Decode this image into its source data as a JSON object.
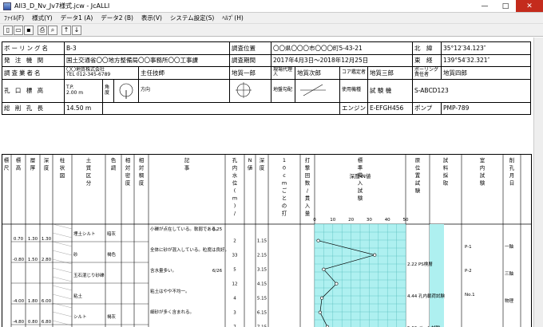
{
  "window": {
    "title": "All3_D_Nv_Jv7様式.jcw - JcALLI",
    "minimize": "—",
    "maximize": "□",
    "close": "✕"
  },
  "menu": [
    "ﾌｧｲﾙ(F)",
    "様式(Y)",
    "データ1 (A)",
    "データ2 (B)",
    "表示(V)",
    "システム設定(S)",
    "ﾍﾙﾌﾟ(H)"
  ],
  "toolbar_icons": [
    "new-icon",
    "open-icon",
    "save-icon",
    "print-icon",
    "search-icon",
    "up-arrow-icon",
    "down-arrow-icon"
  ],
  "toolbar_glyphs": [
    "▯",
    "▭",
    "▪",
    "⎙",
    "⌕",
    "↑",
    "↓"
  ],
  "header": {
    "boring_name_label": "ボーリング名",
    "boring_name": "B-3",
    "survey_loc_label": "調査位置",
    "survey_loc": "〇〇県〇〇〇市〇〇〇町5-43-21",
    "north_label": "北　緯",
    "north": "35°12′34.123″",
    "client_label": "発 注 機 関",
    "client": "国土交通省〇〇地方整備局〇〇事務所〇〇工事課",
    "period_label": "調査期間",
    "period": "2017年4月3日～2018年12月25日",
    "east_label": "東　経",
    "east": "139°54′32.321″",
    "company_label": "調査業者名",
    "company": "〇〇地質株式会社",
    "tel": "TEL 012-345-6789",
    "chief_label": "主任技師",
    "chief": "地質一郎",
    "agent_label": "現場代理人",
    "agent": "地質次郎",
    "core_label": "コア鑑定者",
    "core": "地質三郎",
    "borer_label": "ボーリング責任者",
    "borer": "地質四郎",
    "elev_label": "孔 口 標 高",
    "elev_unit": "T.P.",
    "elev": "2.00 m",
    "angle_label": "角度",
    "dir_label": "方向",
    "ground_slope_label": "地盤勾配",
    "tester_label": "試 験 機",
    "tester": "S-ABCD123",
    "length_label": "総 削 孔 長",
    "length": "14.50 m",
    "hammer_label": "使用機種",
    "engine_label": "エンジン",
    "engine": "E-EFGH456",
    "pump_label": "ポンプ",
    "pump": "PMP-789"
  },
  "columns": [
    "標尺",
    "標高",
    "層厚",
    "深度",
    "柱状図",
    "土質区分",
    "色調",
    "相対密度",
    "相対稠度",
    "記事",
    "孔内水位(m)/測定月日",
    "N値",
    "深度",
    "10cmごとの打撃回数",
    "打撃回数/貫入量",
    "標準貫入試験",
    "原位置試験",
    "試料採取",
    "室内試験",
    "削孔月日"
  ],
  "col_heads": {
    "n_label": "N",
    "depth2": "深度",
    "hits10": "10cmごとの打撃回数",
    "ranges": [
      "0～10",
      "10～20",
      "20～30"
    ],
    "spt_title": "標準貫入試験",
    "nvalue_axis": "深度-N値",
    "ticks": [
      "0",
      "10",
      "20",
      "30",
      "40",
      "50"
    ],
    "insitu": "原位置試験",
    "sample": "試料採取",
    "lab": "室内試験",
    "date": "削孔月日"
  },
  "rows": [
    {
      "elev": "0.70",
      "thick": "1.30",
      "depth": "1.30",
      "soil": "埋土シルト",
      "color": "暗灰",
      "note": "小礫が点在している。軟弱である。"
    },
    {
      "elev": "-0.80",
      "thick": "1.50",
      "depth": "2.80",
      "soil": "砂",
      "color": "褐色",
      "note": "全体に砂が混入している。粒度は良好。"
    },
    {
      "elev": "",
      "thick": "",
      "depth": "",
      "soil": "玉石混じり砂礫",
      "color": "",
      "note": "含水量多い。"
    },
    {
      "elev": "-4.00",
      "thick": "1.80",
      "depth": "6.00",
      "soil": "粘土",
      "color": "",
      "note": "粘土はやや不均一。"
    },
    {
      "elev": "-4.80",
      "thick": "0.80",
      "depth": "6.80",
      "soil": "シルト",
      "color": "褐灰",
      "note": "細砂が多く含まれる。"
    }
  ],
  "n_values": [
    {
      "depth": "1.15",
      "n": "2"
    },
    {
      "depth": "2.15",
      "n": "33"
    },
    {
      "depth": "3.15",
      "n": "5"
    },
    {
      "depth": "4.15",
      "n": "12"
    },
    {
      "depth": "5.15",
      "n": "4"
    },
    {
      "depth": "6.15",
      "n": "3"
    },
    {
      "depth": "7.15",
      "n": "7"
    }
  ],
  "water_level": {
    "value": "0.25",
    "date": "6/26"
  },
  "insitu_tests": [
    "2.22 PS検層",
    "4.44 孔内載荷試験",
    "5.66 ベーン試験"
  ],
  "samples": [
    "P-1",
    "P-2",
    "No.1"
  ],
  "lab_tests": [
    "一軸",
    "三軸",
    "物理"
  ],
  "chart_data": {
    "type": "line",
    "title": "深度-N値",
    "xlabel": "N値",
    "ylabel": "深度(m)",
    "xlim": [
      0,
      50
    ],
    "x": [
      2,
      33,
      5,
      12,
      4,
      3,
      7
    ],
    "y": [
      1.15,
      2.15,
      3.15,
      4.15,
      5.15,
      6.15,
      7.15
    ]
  }
}
